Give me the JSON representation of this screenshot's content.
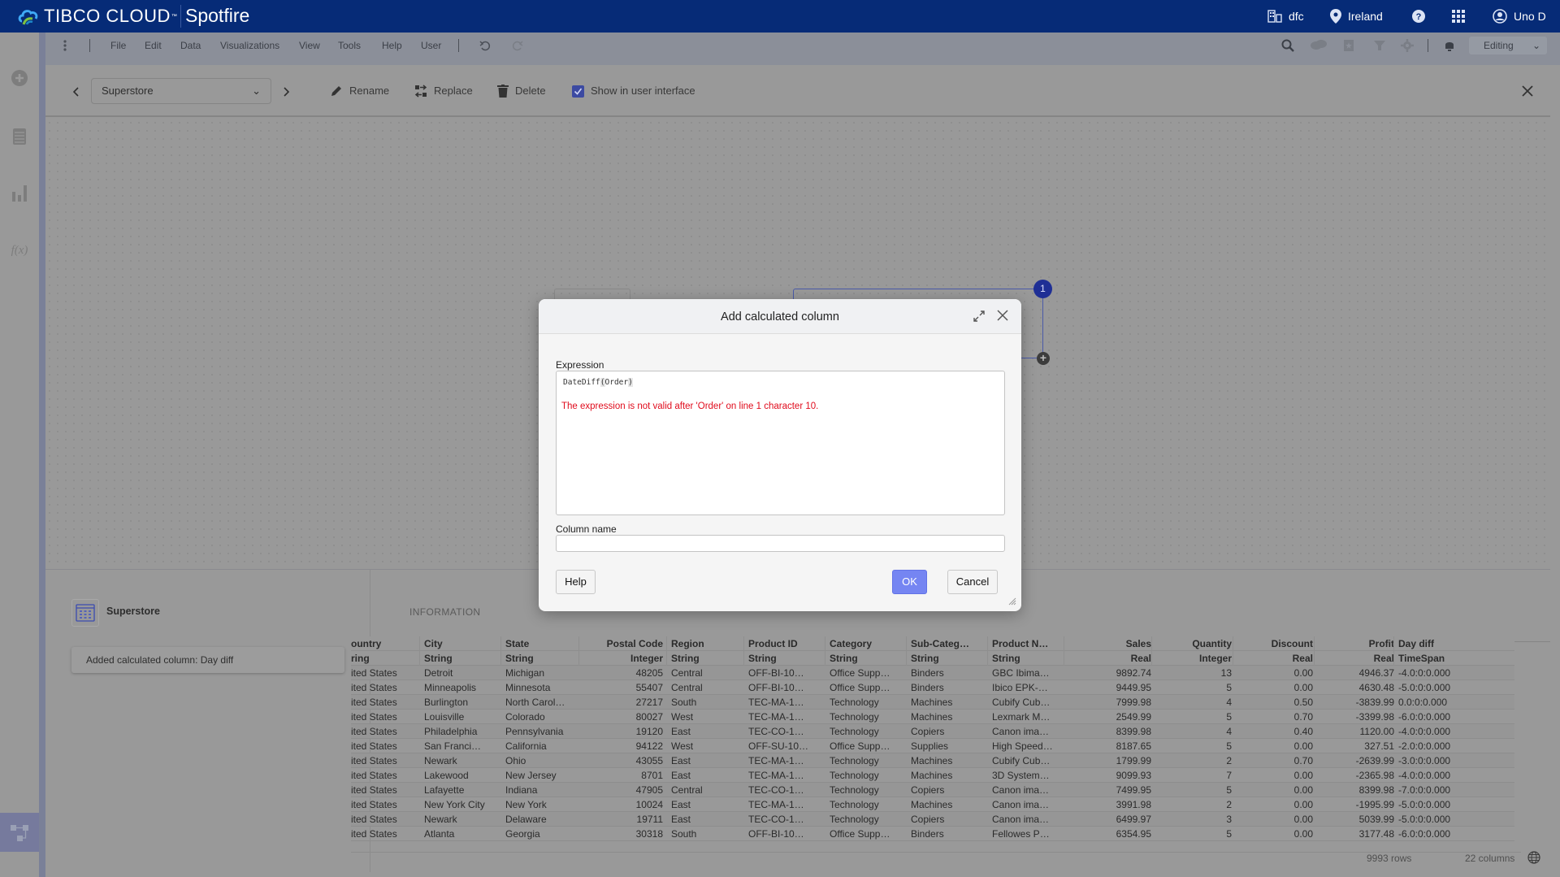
{
  "header": {
    "brand": "TIBCO CLOUD",
    "trademark": "™",
    "app_name": "Spotfire",
    "org": "dfc",
    "region": "Ireland",
    "user": "Uno D",
    "icons": {
      "org": "building-icon",
      "region": "location-pin-icon",
      "help": "help-icon",
      "apps": "app-grid-icon",
      "user": "user-avatar-icon"
    }
  },
  "menubar": {
    "items": [
      "File",
      "Edit",
      "Data",
      "Visualizations",
      "View",
      "Tools",
      "Help",
      "User"
    ],
    "mode": "Editing"
  },
  "toolbar": {
    "data_table": "Superstore",
    "rename": "Rename",
    "replace": "Replace",
    "delete": "Delete",
    "show_in_ui": "Show in user interface",
    "show_in_ui_checked": true
  },
  "canvas": {
    "node_badge": "1"
  },
  "bottom_panel": {
    "data_table_name": "Superstore",
    "history_item": "Added calculated column: Day diff",
    "tab_information": "INFORMATION",
    "table": {
      "columns": [
        {
          "name": "Country",
          "type": "String",
          "display_name": "ountry",
          "display_type": "ring"
        },
        {
          "name": "City",
          "type": "String"
        },
        {
          "name": "State",
          "type": "String"
        },
        {
          "name": "Postal Code",
          "type": "Integer"
        },
        {
          "name": "Region",
          "type": "String"
        },
        {
          "name": "Product ID",
          "type": "String"
        },
        {
          "name": "Category",
          "type": "String"
        },
        {
          "name": "Sub-Categ…",
          "type": "String"
        },
        {
          "name": "Product N…",
          "type": "String"
        },
        {
          "name": "Sales",
          "type": "Real"
        },
        {
          "name": "Quantity",
          "type": "Integer"
        },
        {
          "name": "Discount",
          "type": "Real"
        },
        {
          "name": "Profit",
          "type": "Real"
        },
        {
          "name": "Day diff",
          "type": "TimeSpan"
        }
      ],
      "rows": [
        [
          "ited States",
          "Detroit",
          "Michigan",
          "48205",
          "Central",
          "OFF-BI-10…",
          "Office Supp…",
          "Binders",
          "GBC Ibima…",
          "9892.74",
          "13",
          "0.00",
          "4946.37",
          "-4.0:0:0.000"
        ],
        [
          "ited States",
          "Minneapolis",
          "Minnesota",
          "55407",
          "Central",
          "OFF-BI-10…",
          "Office Supp…",
          "Binders",
          "Ibico EPK-…",
          "9449.95",
          "5",
          "0.00",
          "4630.48",
          "-5.0:0:0.000"
        ],
        [
          "ited States",
          "Burlington",
          "North Carol…",
          "27217",
          "South",
          "TEC-MA-1…",
          "Technology",
          "Machines",
          "Cubify Cub…",
          "7999.98",
          "4",
          "0.50",
          "-3839.99",
          "0.0:0:0.000"
        ],
        [
          "ited States",
          "Louisville",
          "Colorado",
          "80027",
          "West",
          "TEC-MA-1…",
          "Technology",
          "Machines",
          "Lexmark M…",
          "2549.99",
          "5",
          "0.70",
          "-3399.98",
          "-6.0:0:0.000"
        ],
        [
          "ited States",
          "Philadelphia",
          "Pennsylvania",
          "19120",
          "East",
          "TEC-CO-1…",
          "Technology",
          "Copiers",
          "Canon ima…",
          "8399.98",
          "4",
          "0.40",
          "1120.00",
          "-4.0:0:0.000"
        ],
        [
          "ited States",
          "San Franci…",
          "California",
          "94122",
          "West",
          "OFF-SU-10…",
          "Office Supp…",
          "Supplies",
          "High Speed…",
          "8187.65",
          "5",
          "0.00",
          "327.51",
          "-2.0:0:0.000"
        ],
        [
          "ited States",
          "Newark",
          "Ohio",
          "43055",
          "East",
          "TEC-MA-1…",
          "Technology",
          "Machines",
          "Cubify Cub…",
          "1799.99",
          "2",
          "0.70",
          "-2639.99",
          "-3.0:0:0.000"
        ],
        [
          "ited States",
          "Lakewood",
          "New Jersey",
          "8701",
          "East",
          "TEC-MA-1…",
          "Technology",
          "Machines",
          "3D System…",
          "9099.93",
          "7",
          "0.00",
          "-2365.98",
          "-4.0:0:0.000"
        ],
        [
          "ited States",
          "Lafayette",
          "Indiana",
          "47905",
          "Central",
          "TEC-CO-1…",
          "Technology",
          "Copiers",
          "Canon ima…",
          "7499.95",
          "5",
          "0.00",
          "8399.98",
          "-7.0:0:0.000"
        ],
        [
          "ited States",
          "New York City",
          "New York",
          "10024",
          "East",
          "TEC-MA-1…",
          "Technology",
          "Machines",
          "Canon ima…",
          "3991.98",
          "2",
          "0.00",
          "-1995.99",
          "-5.0:0:0.000"
        ],
        [
          "ited States",
          "Newark",
          "Delaware",
          "19711",
          "East",
          "TEC-CO-1…",
          "Technology",
          "Copiers",
          "Canon ima…",
          "6499.97",
          "3",
          "0.00",
          "5039.99",
          "-5.0:0:0.000"
        ],
        [
          "ited States",
          "Atlanta",
          "Georgia",
          "30318",
          "South",
          "OFF-BI-10…",
          "Office Supp…",
          "Binders",
          "Fellowes P…",
          "6354.95",
          "5",
          "0.00",
          "3177.48",
          "-6.0:0:0.000"
        ]
      ],
      "row_count": "9993 rows",
      "column_count": "22 columns"
    }
  },
  "dialog": {
    "title": "Add calculated column",
    "expression_label": "Expression",
    "expression_fn": "DateDiff",
    "expression_open": "(",
    "expression_arg": "Order",
    "expression_close": ")",
    "expression_value": "DateDiff(Order)",
    "error_message": "The expression is not valid after 'Order' on line 1 character 10.",
    "column_name_label": "Column name",
    "column_name_value": "",
    "help_button": "Help",
    "ok_button": "OK",
    "cancel_button": "Cancel"
  },
  "colors": {
    "header_bg": "#062b77",
    "accent": "#1f2f95",
    "ok_button": "#7585f2",
    "error_text": "#e00b1c"
  }
}
